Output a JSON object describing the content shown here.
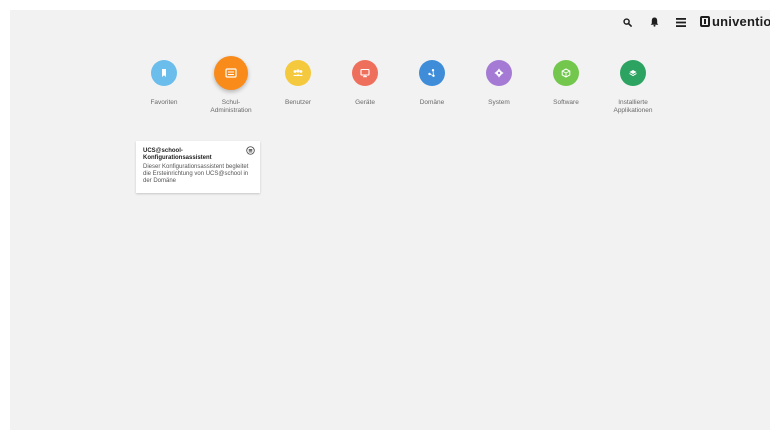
{
  "header": {
    "icons": {
      "search": "search-icon",
      "notifications": "bell-icon",
      "menu": "menu-icon"
    },
    "logo_text": "univention"
  },
  "categories": [
    {
      "label": "Favoriten",
      "color": "#6bbdeb",
      "icon": "bookmark-icon",
      "active": false
    },
    {
      "label": "Schul-\nAdministration",
      "color": "#f88b1a",
      "icon": "school-admin-icon",
      "active": true
    },
    {
      "label": "Benutzer",
      "color": "#f5c93d",
      "icon": "users-icon",
      "active": false
    },
    {
      "label": "Geräte",
      "color": "#ef6f5d",
      "icon": "monitor-icon",
      "active": false
    },
    {
      "label": "Domäne",
      "color": "#3f8cd9",
      "icon": "domain-icon",
      "active": false
    },
    {
      "label": "System",
      "color": "#a47ad5",
      "icon": "gear-icon",
      "active": false
    },
    {
      "label": "Software",
      "color": "#73c74d",
      "icon": "box-icon",
      "active": false
    },
    {
      "label": "Installierte\nApplikationen",
      "color": "#2da361",
      "icon": "apps-icon",
      "active": false
    }
  ],
  "tile": {
    "title": "UCS@school-\nKonfigurationsassistent",
    "description": "Dieser Konfigurationsassistent begleitet die Ersteinrichtung von UCS@school in der Domäne",
    "fav_icon": "favorite-toggle-icon"
  }
}
